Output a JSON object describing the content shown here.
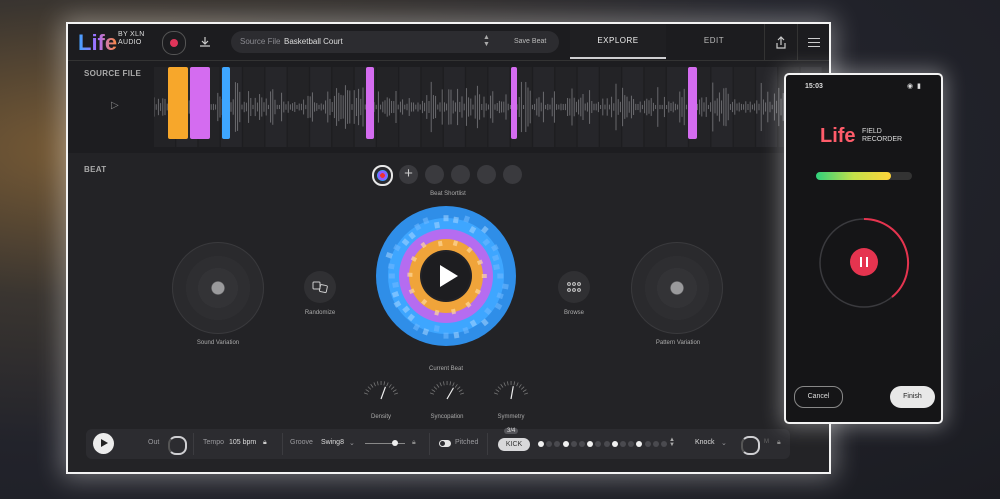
{
  "app": {
    "logo": "Life",
    "logo_sub": "BY XLN\nAUDIO",
    "source_label": "Source File",
    "source_value": "Basketball Court",
    "save_beat": "Save Beat",
    "tabs": [
      "EXPLORE",
      "EDIT"
    ],
    "active_tab": "EXPLORE",
    "icons": {
      "record": "record-icon",
      "download": "download-icon",
      "share": "share-icon",
      "menu": "menu-icon"
    }
  },
  "source_section": {
    "title": "SOURCE FILE",
    "play_icon": "play-icon"
  },
  "beat_section": {
    "title": "BEAT",
    "shortlist_label": "Beat Shortlist",
    "sound_variation": "Sound Variation",
    "randomize": "Randomize",
    "current_beat": "Current Beat",
    "browse": "Browse",
    "pattern_variation": "Pattern Variation",
    "dials": [
      "Density",
      "Syncopation",
      "Symmetry"
    ]
  },
  "transport": {
    "out": "Out",
    "tempo_label": "Tempo",
    "tempo_value": "105 bpm",
    "groove_label": "Groove",
    "groove_value": "Swing8",
    "pitched": "Pitched",
    "kick": "KICK",
    "kick_badge": "3/4",
    "knock": "Knock",
    "steps": [
      1,
      0,
      0,
      1,
      0,
      0,
      1,
      0,
      0,
      1,
      0,
      0,
      1,
      0,
      0,
      0
    ]
  },
  "phone": {
    "time": "15:03",
    "logo": "Life",
    "logo_sub": "FIELD\nRECORDER",
    "level": 0.78,
    "cancel": "Cancel",
    "finish": "Finish"
  },
  "colors": {
    "orange": "#f7a72b",
    "pink": "#d46cf0",
    "blue": "#3ea6ff",
    "record_red": "#e5344f"
  }
}
